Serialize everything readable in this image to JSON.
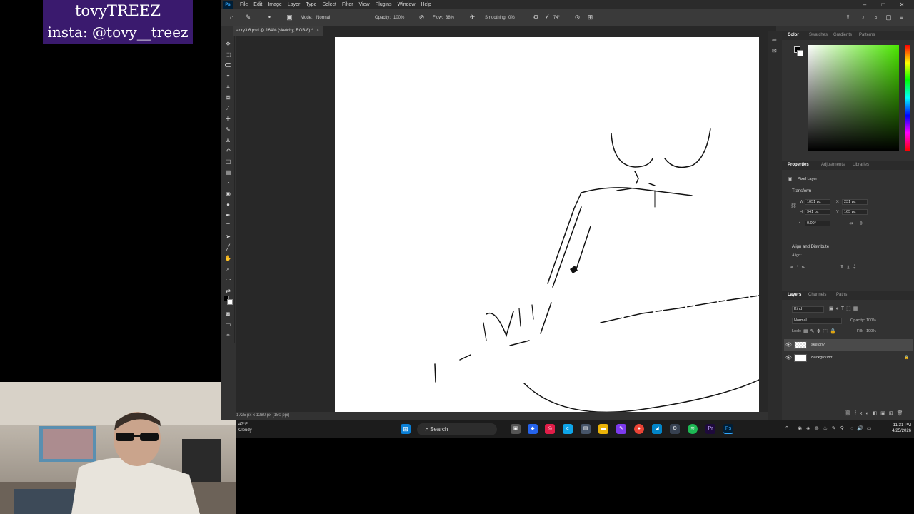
{
  "overlay": {
    "line1": "tovyTREEZ",
    "line2": "insta: @tovy__treez"
  },
  "menu": [
    "File",
    "Edit",
    "Image",
    "Layer",
    "Type",
    "Select",
    "Filter",
    "View",
    "Plugins",
    "Window",
    "Help"
  ],
  "options": {
    "mode_label": "Mode:",
    "mode_value": "Normal",
    "opacity_label": "Opacity:",
    "opacity_value": "100%",
    "flow_label": "Flow:",
    "flow_value": "38%",
    "smoothing_label": "Smoothing:",
    "smoothing_value": "0%",
    "angle_value": "74°"
  },
  "document": {
    "tab_title": "story3.6.psd @ 164% (sketchy, RGB/8) *",
    "status": "1725 px x 1280 px (150 ppi)"
  },
  "panels": {
    "color_tabs": [
      "Color",
      "Swatches",
      "Gradients",
      "Patterns"
    ],
    "props_tabs": [
      "Properties",
      "Adjustments",
      "Libraries"
    ],
    "pixel_layer": "Pixel Layer",
    "transform_title": "Transform",
    "w_label": "W",
    "w_value": "1051 px",
    "x_label": "X",
    "x_value": "231 px",
    "h_label": "H",
    "h_value": "941 px",
    "y_label": "Y",
    "y_value": "165 px",
    "angle_value": "0.00°",
    "align_title": "Align and Distribute",
    "align_label": "Align:",
    "layers_tabs": [
      "Layers",
      "Channels",
      "Paths"
    ],
    "kind_value": "Kind",
    "blend_value": "Normal",
    "opacity_label": "Opacity:",
    "opacity_value": "100%",
    "lock_label": "Lock:",
    "fill_label": "Fill:",
    "fill_value": "100%",
    "layers": [
      {
        "name": "sketchy",
        "selected": true
      },
      {
        "name": "Background",
        "selected": false
      }
    ]
  },
  "taskbar": {
    "temp": "47°F",
    "condition": "Cloudy",
    "search_placeholder": "Search",
    "time": "11:31 PM",
    "date": "4/25/2026"
  },
  "colors": {
    "overlay_bg": "#3a1a6e",
    "ps_bg": "#323232",
    "canvas": "#ffffff",
    "accent": "#31a8ff"
  }
}
